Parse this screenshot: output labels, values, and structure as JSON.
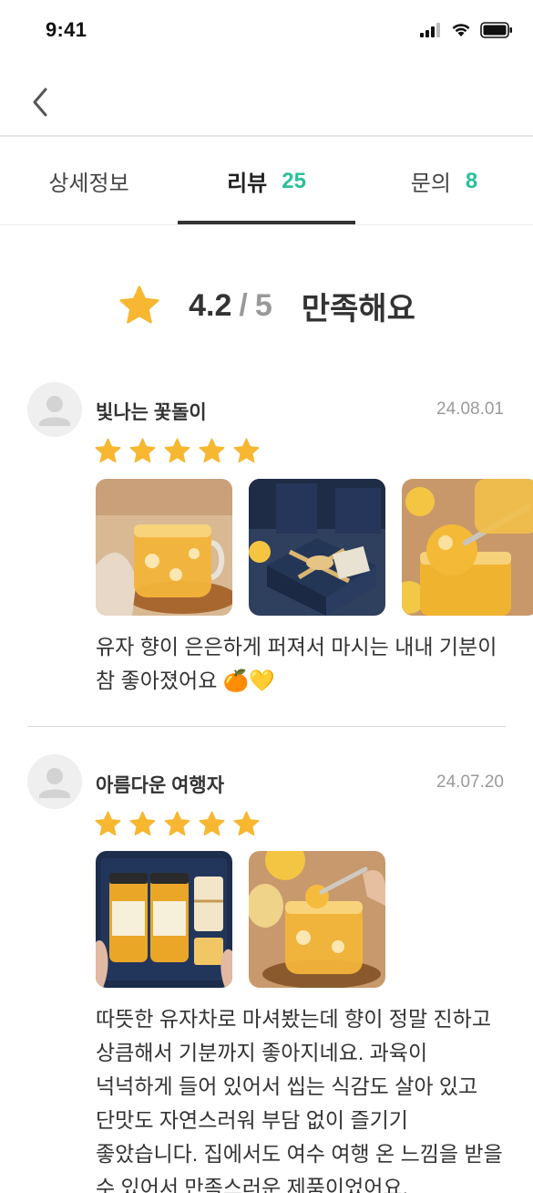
{
  "status_bar": {
    "time": "9:41"
  },
  "tabs": [
    {
      "label": "상세정보",
      "count": ""
    },
    {
      "label": "리뷰",
      "count": "25"
    },
    {
      "label": "문의",
      "count": "8"
    }
  ],
  "rating": {
    "score": "4.2",
    "separator": "/",
    "max": "5",
    "text": "만족해요"
  },
  "reviews": [
    {
      "name": "빛나는 꽃돌이",
      "date": "24.08.01",
      "stars": 5,
      "photos": [
        "yuja-tea-cup-photo",
        "gift-box-photo",
        "yuja-jar-spoon-photo"
      ],
      "body": "유자 향이 은은하게 퍼져서 마시는 내내 기분이 참 좋아졌어요 🍊💛"
    },
    {
      "name": "아름다운 여행자",
      "date": "24.07.20",
      "stars": 5,
      "photos": [
        "gift-set-jars-photo",
        "yuja-tea-spoon-photo"
      ],
      "body": "따뜻한 유자차로 마셔봤는데 향이 정말 진하고 상큼해서 기분까지 좋아지네요. 과육이 넉넉하게 들어 있어서 씹는 식감도 살아 있고 단맛도 자연스러워 부담 없이 즐기기 좋았습니다. 집에서도 여수 여행 온 느낌을 받을 수 있어서 만족스러운 제품이었어요."
    }
  ],
  "colors": {
    "accent": "#2bbf9a",
    "star": "#f7b731",
    "text": "#333333",
    "muted": "#9a9a9a"
  },
  "icons": [
    "signal-icon",
    "wifi-icon",
    "battery-icon",
    "back-arrow-icon",
    "star-icon",
    "user-avatar-icon"
  ]
}
